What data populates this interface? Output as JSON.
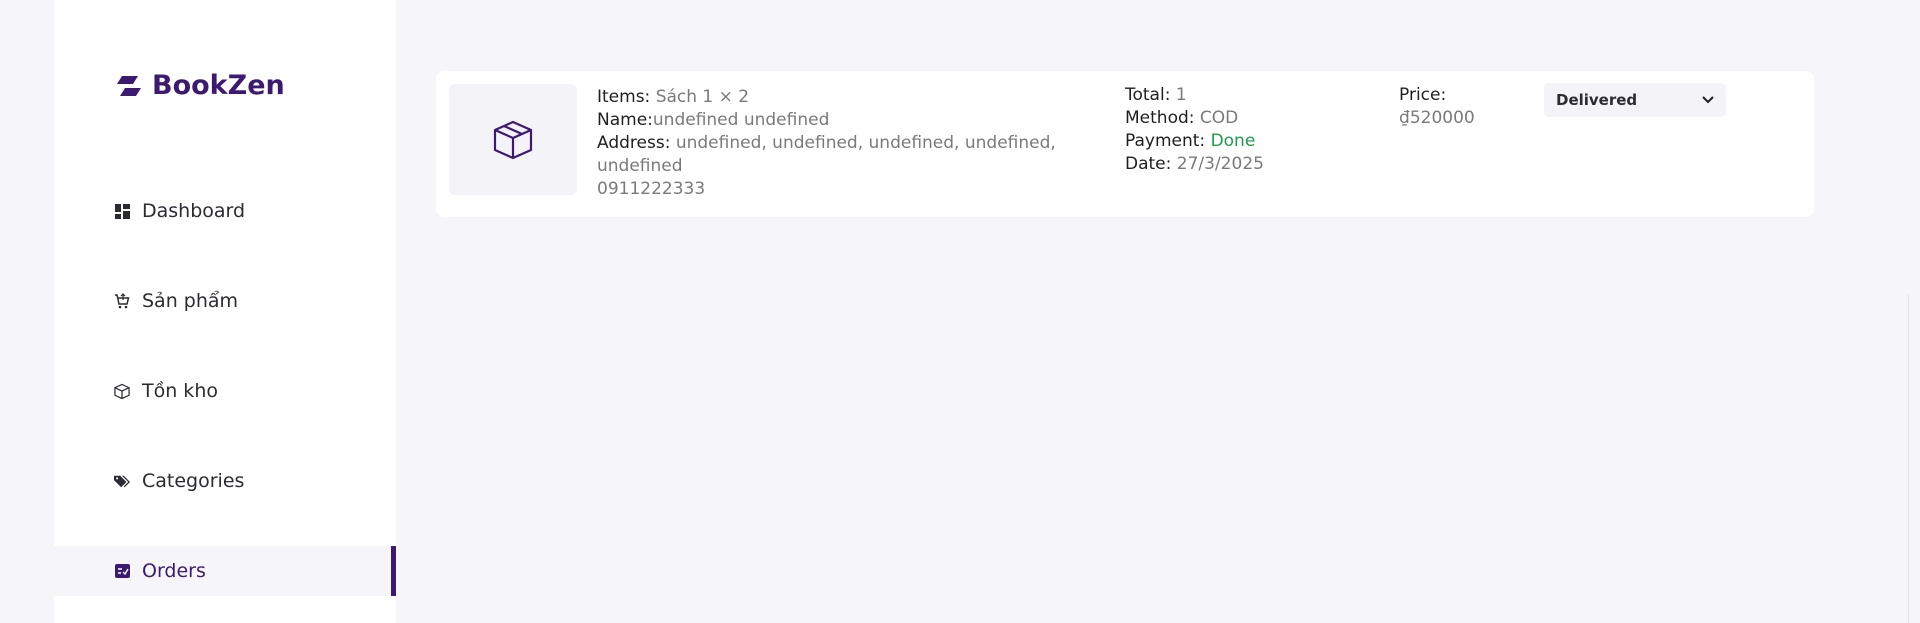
{
  "brand": {
    "name": "BookZen",
    "color": "#3d1a72"
  },
  "sidebar": {
    "items": [
      {
        "label": "Dashboard",
        "icon": "dashboard-icon"
      },
      {
        "label": "Sản phẩm",
        "icon": "cart-icon"
      },
      {
        "label": "Tồn kho",
        "icon": "box-icon"
      },
      {
        "label": "Categories",
        "icon": "tags-icon"
      },
      {
        "label": "Orders",
        "icon": "orders-icon",
        "active": true
      }
    ]
  },
  "order": {
    "items_label": "Items:",
    "items_value": "Sách 1 × 2",
    "name_label": "Name:",
    "name_value": "undefined undefined",
    "address_label": "Address:",
    "address_value": "undefined, undefined, undefined, undefined, undefined",
    "phone": "0911222333",
    "total_label": "Total:",
    "total_value": "1",
    "method_label": "Method:",
    "method_value": "COD",
    "payment_label": "Payment:",
    "payment_value": "Done",
    "date_label": "Date:",
    "date_value": "27/3/2025",
    "price_label": "Price:",
    "price_value": "₫520000",
    "status_selected": "Delivered",
    "thumbnail_icon": "package-icon"
  },
  "colors": {
    "accent": "#3d1a72",
    "success": "#1e9b4e",
    "background": "#f6f5fa"
  }
}
